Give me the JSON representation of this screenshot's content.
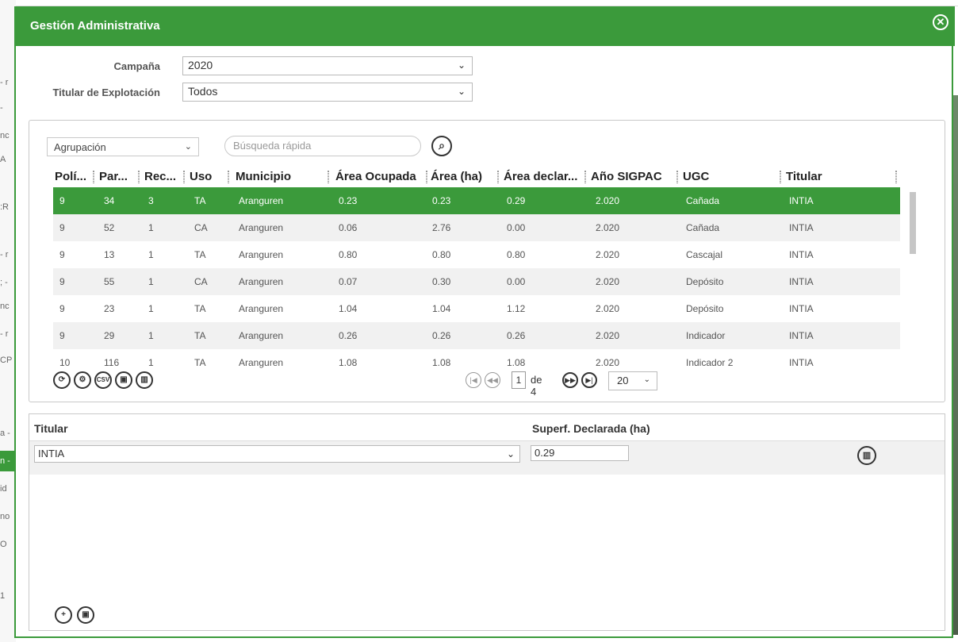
{
  "modal": {
    "title": "Gestión Administrativa",
    "close_icon": "close-icon"
  },
  "filters": {
    "campaign_label": "Campaña",
    "campaign_value": "2020",
    "owner_label": "Titular de Explotación",
    "owner_value": "Todos"
  },
  "grid": {
    "grouping_value": "Agrupación",
    "search_placeholder": "Búsqueda rápida",
    "columns": [
      "Polí...",
      "Par...",
      "Rec...",
      "Uso",
      "Municipio",
      "Área Ocupada",
      "Área (ha)",
      "Área declar...",
      "Año SIGPAC",
      "UGC",
      "Titular"
    ],
    "rows": [
      [
        "9",
        "34",
        "3",
        "TA",
        "Aranguren",
        "0.23",
        "0.23",
        "0.29",
        "2.020",
        "Cañada",
        "INTIA"
      ],
      [
        "9",
        "52",
        "1",
        "CA",
        "Aranguren",
        "0.06",
        "2.76",
        "0.00",
        "2.020",
        "Cañada",
        "INTIA"
      ],
      [
        "9",
        "13",
        "1",
        "TA",
        "Aranguren",
        "0.80",
        "0.80",
        "0.80",
        "2.020",
        "Cascajal",
        "INTIA"
      ],
      [
        "9",
        "55",
        "1",
        "CA",
        "Aranguren",
        "0.07",
        "0.30",
        "0.00",
        "2.020",
        "Depósito",
        "INTIA"
      ],
      [
        "9",
        "23",
        "1",
        "TA",
        "Aranguren",
        "1.04",
        "1.04",
        "1.12",
        "2.020",
        "Depósito",
        "INTIA"
      ],
      [
        "9",
        "29",
        "1",
        "TA",
        "Aranguren",
        "0.26",
        "0.26",
        "0.26",
        "2.020",
        "Indicador",
        "INTIA"
      ],
      [
        "10",
        "116",
        "1",
        "TA",
        "Aranguren",
        "1.08",
        "1.08",
        "1.08",
        "2.020",
        "Indicador 2",
        "INTIA"
      ]
    ],
    "selected_row": 0,
    "toolbar_icons": [
      "refresh-icon",
      "settings-icon",
      "csv-export-icon",
      "save-icon",
      "delete-icon"
    ],
    "csv_label": "CSV",
    "pager": {
      "current_page": "1",
      "of_text": "de 4",
      "page_size": "20"
    }
  },
  "detail": {
    "owner_header": "Titular",
    "area_header": "Superf. Declarada (ha)",
    "owner_value": "INTIA",
    "area_value": "0.29",
    "toolbar_icons": [
      "add-icon",
      "save-icon"
    ]
  },
  "colors": {
    "accent": "#3b9a3b",
    "row_alt": "#f1f1f1"
  }
}
